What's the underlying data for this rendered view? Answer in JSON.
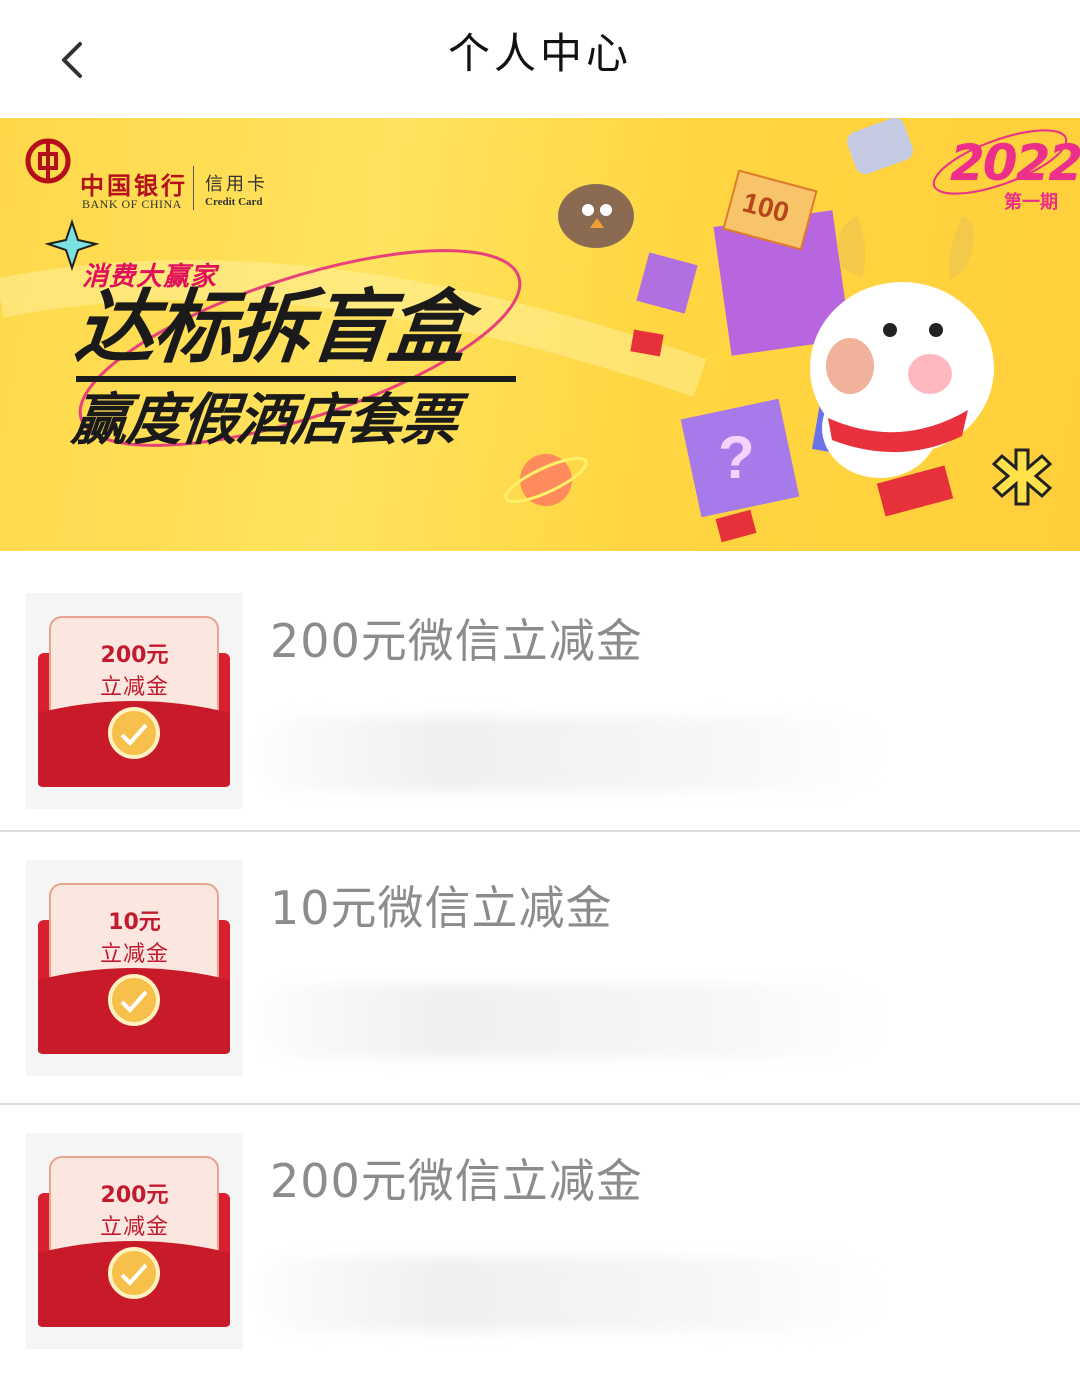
{
  "header": {
    "title": "个人中心",
    "back_icon": "chevron-left-icon"
  },
  "banner": {
    "bank_name_cn": "中国银行",
    "bank_name_en": "BANK OF CHINA",
    "card_cn": "信用卡",
    "card_en": "Credit Card",
    "tagline": "消费大赢家",
    "headline_1": "达标拆盲盒",
    "headline_2": "赢度假酒店套票",
    "year": "2022",
    "issue": "第一期",
    "colors": {
      "background": "#ffd84a",
      "accent": "#ec2f8a",
      "brand_red": "#b3101c"
    }
  },
  "items": [
    {
      "title": "200元微信立减金",
      "envelope_amount": "200元",
      "envelope_label": "立减金",
      "icon": "wechat-pay-icon"
    },
    {
      "title": "10元微信立减金",
      "envelope_amount": "10元",
      "envelope_label": "立减金",
      "icon": "wechat-pay-icon"
    },
    {
      "title": "200元微信立减金",
      "envelope_amount": "200元",
      "envelope_label": "立减金",
      "icon": "wechat-pay-icon"
    }
  ]
}
